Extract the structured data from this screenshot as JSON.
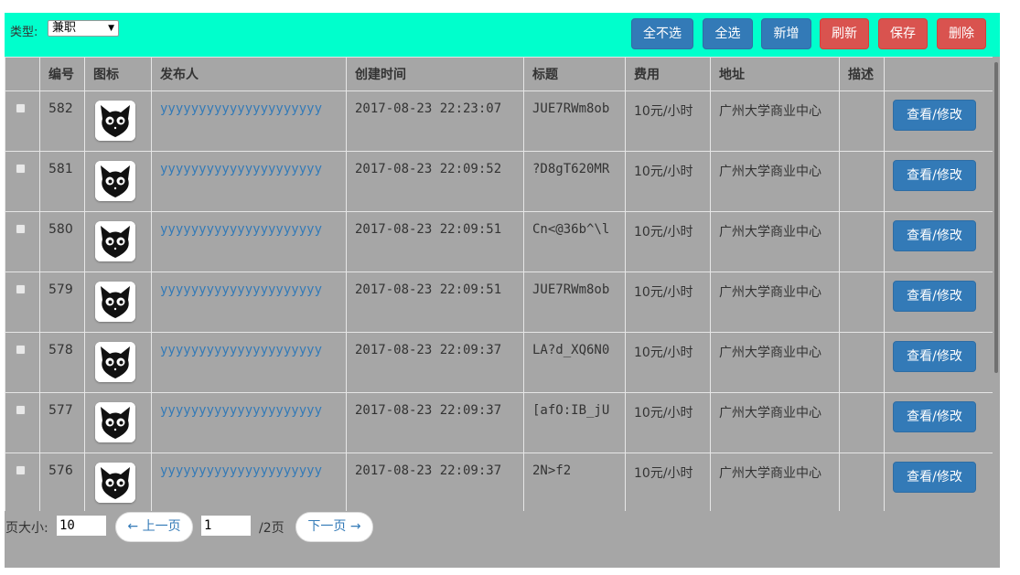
{
  "toolbar": {
    "type_label": "类型:",
    "type_value": "兼职",
    "buttons": {
      "deselect_all": "全不选",
      "select_all": "全选",
      "add": "新增",
      "refresh": "刷新",
      "save": "保存",
      "delete": "删除"
    }
  },
  "table": {
    "headers": [
      "",
      "编号",
      "图标",
      "发布人",
      "创建时间",
      "标题",
      "费用",
      "地址",
      "描述",
      ""
    ],
    "action_label": "查看/修改",
    "rows": [
      {
        "id": "582",
        "publisher": "yyyyyyyyyyyyyyyyyyyyy",
        "created": "2017-08-23 22:23:07",
        "title": "JUE7RWm8ob",
        "fee": "10元/小时",
        "address": "广州大学商业中心",
        "desc": ""
      },
      {
        "id": "581",
        "publisher": "yyyyyyyyyyyyyyyyyyyyy",
        "created": "2017-08-23 22:09:52",
        "title": "?D8gT620MR",
        "fee": "10元/小时",
        "address": "广州大学商业中心",
        "desc": ""
      },
      {
        "id": "580",
        "publisher": "yyyyyyyyyyyyyyyyyyyyy",
        "created": "2017-08-23 22:09:51",
        "title": "Cn<@36b^\\l",
        "fee": "10元/小时",
        "address": "广州大学商业中心",
        "desc": ""
      },
      {
        "id": "579",
        "publisher": "yyyyyyyyyyyyyyyyyyyyy",
        "created": "2017-08-23 22:09:51",
        "title": "JUE7RWm8ob",
        "fee": "10元/小时",
        "address": "广州大学商业中心",
        "desc": ""
      },
      {
        "id": "578",
        "publisher": "yyyyyyyyyyyyyyyyyyyyy",
        "created": "2017-08-23 22:09:37",
        "title": "LA?d_XQ6N0",
        "fee": "10元/小时",
        "address": "广州大学商业中心",
        "desc": ""
      },
      {
        "id": "577",
        "publisher": "yyyyyyyyyyyyyyyyyyyyy",
        "created": "2017-08-23 22:09:37",
        "title": "[afO:IB_jU",
        "fee": "10元/小时",
        "address": "广州大学商业中心",
        "desc": ""
      },
      {
        "id": "576",
        "publisher": "yyyyyyyyyyyyyyyyyyyyy",
        "created": "2017-08-23 22:09:37",
        "title": "2N>f2",
        "fee": "10元/小时",
        "address": "广州大学商业中心",
        "desc": ""
      }
    ]
  },
  "pager": {
    "page_size_label": "页大小:",
    "page_size": "10",
    "prev_label": "← 上一页",
    "current_page": "1",
    "total_label": "/2页",
    "next_label": "下一页 →"
  },
  "colors": {
    "toolbar_bg": "#00ffcc",
    "panel_bg": "#a6a6a6",
    "primary": "#337ab7",
    "danger": "#d9534f",
    "link": "#337ab7"
  },
  "icons": {
    "row_icon": "cat-face-icon",
    "select_arrow": "dropdown-arrow-icon"
  }
}
